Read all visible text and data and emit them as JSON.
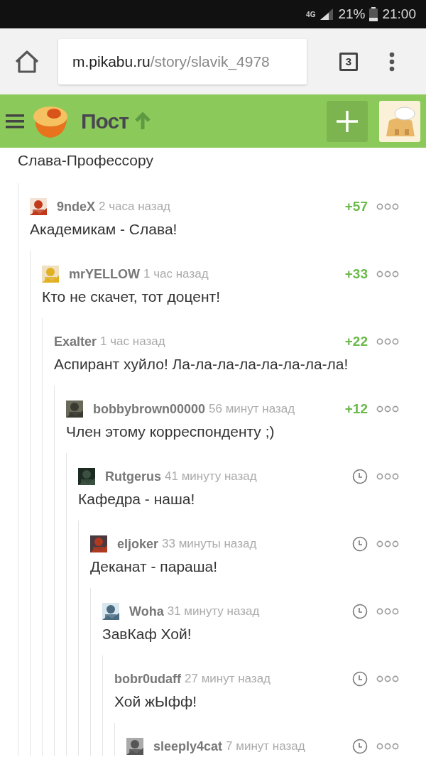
{
  "status_bar": {
    "network": "4G",
    "battery": "21%",
    "time": "21:00"
  },
  "browser": {
    "url_host": "m.pikabu.ru",
    "url_path": "/story/slavik_4978",
    "tab_count": "3"
  },
  "header": {
    "title": "Пост"
  },
  "previous_text": "Слава-Профессору",
  "comments": [
    {
      "user": "9ndeX",
      "time": "2 часа назад",
      "kind": "rated",
      "rating": "+57",
      "avatar": true,
      "text": "Академикам - Слава!",
      "children": [
        {
          "user": "mrYELLOW",
          "time": "1 час назад",
          "kind": "rated",
          "rating": "+33",
          "avatar": true,
          "text": "Кто не скачет, тот доцент!",
          "children": [
            {
              "user": "Exalter",
              "time": "1 час назад",
              "kind": "rated",
              "rating": "+22",
              "avatar": false,
              "text": "Аспирант хуйло! Ла-ла-ла-ла-ла-ла-ла-ла!",
              "children": [
                {
                  "user": "bobbybrown00000",
                  "time": "56 минут назад",
                  "kind": "rated",
                  "rating": "+12",
                  "avatar": true,
                  "text": "Член этому корреспонденту ;)",
                  "children": [
                    {
                      "user": "Rutgerus",
                      "time": "41 минуту назад",
                      "kind": "pending",
                      "avatar": true,
                      "text": "Кафедра - наша!",
                      "children": [
                        {
                          "user": "eljoker",
                          "time": "33 минуты назад",
                          "kind": "pending",
                          "avatar": true,
                          "text": "Деканат - параша!",
                          "children": [
                            {
                              "user": "Woha",
                              "time": "31 минуту назад",
                              "kind": "pending",
                              "avatar": true,
                              "text": "ЗавКаф Хой!",
                              "children": [
                                {
                                  "user": "bobr0udaff",
                                  "time": "27 минут назад",
                                  "kind": "pending",
                                  "avatar": false,
                                  "text": "Хой жЫфф!",
                                  "children": [
                                    {
                                      "user": "sleeply4cat",
                                      "time": "7 минут назад",
                                      "kind": "pending",
                                      "avatar": true
                                    }
                                  ]
                                }
                              ]
                            }
                          ]
                        }
                      ]
                    }
                  ]
                }
              ]
            }
          ]
        }
      ]
    }
  ]
}
